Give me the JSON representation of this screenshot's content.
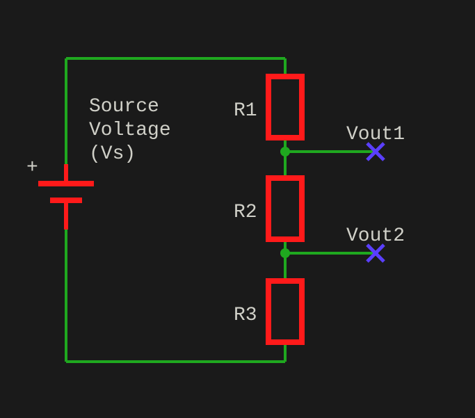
{
  "source": {
    "label_line1": "Source",
    "label_line2": "Voltage",
    "label_line3": "(Vs)"
  },
  "resistors": {
    "r1": "R1",
    "r2": "R2",
    "r3": "R3"
  },
  "outputs": {
    "vout1": "Vout1",
    "vout2": "Vout2"
  },
  "colors": {
    "wire": "#1fa81f",
    "component": "#ff1a1a",
    "terminal": "#5a3fff",
    "node": "#1fa81f",
    "bg": "#1a1a1a"
  }
}
